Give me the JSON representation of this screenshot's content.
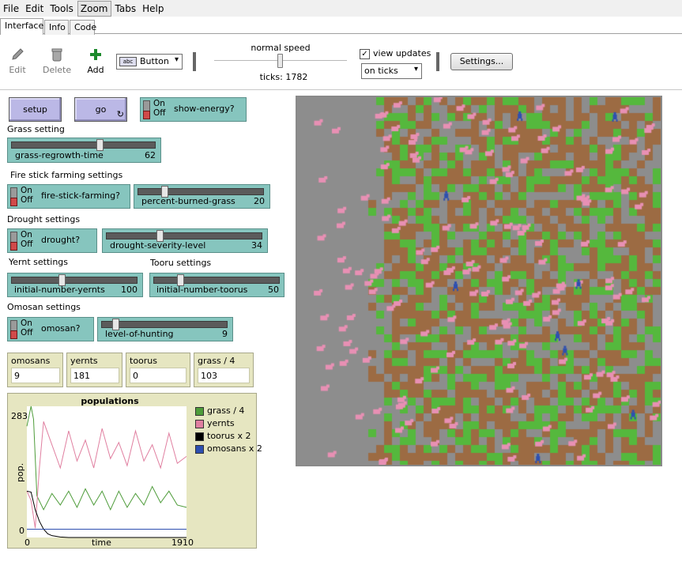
{
  "menubar": {
    "items": [
      "File",
      "Edit",
      "Tools",
      "Zoom",
      "Tabs",
      "Help"
    ]
  },
  "tabs": [
    "Interface",
    "Info",
    "Code"
  ],
  "toolbar": {
    "edit_label": "Edit",
    "delete_label": "Delete",
    "add_label": "Add",
    "widget_type": "Button",
    "speed_label": "normal speed",
    "speed_value": 0.5,
    "ticks_text": "ticks: 1782",
    "view_updates_label": "view updates",
    "view_updates_checked": true,
    "update_mode": "on ticks",
    "settings_label": "Settings..."
  },
  "buttons": {
    "setup": "setup",
    "go": "go"
  },
  "switches": {
    "show_energy": {
      "label": "show-energy?",
      "on": "On",
      "off": "Off",
      "state": "off"
    },
    "fire_stick": {
      "label": "fire-stick-farming?",
      "on": "On",
      "off": "Off",
      "state": "off"
    },
    "drought": {
      "label": "drought?",
      "on": "On",
      "off": "Off",
      "state": "off"
    },
    "omosan": {
      "label": "omosan?",
      "on": "On",
      "off": "Off",
      "state": "off"
    }
  },
  "sections": {
    "grass": "Grass setting",
    "fire": "Fire stick farming settings",
    "drought": "Drought settings",
    "yernt": "Yernt settings",
    "tooru": "Tooru settings",
    "omosan": "Omosan settings"
  },
  "sliders": {
    "grass_regrowth_time": {
      "label": "grass-regrowth-time",
      "value": "62",
      "fraction": 0.62
    },
    "percent_burned_grass": {
      "label": "percent-burned-grass",
      "value": "20",
      "fraction": 0.2
    },
    "drought_severity_level": {
      "label": "drought-severity-level",
      "value": "34",
      "fraction": 0.34
    },
    "initial_number_yernts": {
      "label": "initial-number-yernts",
      "value": "100",
      "fraction": 0.4
    },
    "initial_number_toorus": {
      "label": "initial-number-toorus",
      "value": "50",
      "fraction": 0.2
    },
    "level_of_hunting": {
      "label": "level-of-hunting",
      "value": "9",
      "fraction": 0.09
    }
  },
  "monitors": [
    {
      "label": "omosans",
      "value": "9"
    },
    {
      "label": "yernts",
      "value": "181"
    },
    {
      "label": "toorus",
      "value": "0"
    },
    {
      "label": "grass / 4",
      "value": "103"
    }
  ],
  "plot": {
    "title": "populations",
    "ylabel": "pop.",
    "xlabel": "time",
    "y_max_label": "283",
    "y_min_label": "0",
    "x_min_label": "0",
    "x_max_label": "1910",
    "legend": [
      {
        "name": "grass / 4",
        "color": "#4e9c3a"
      },
      {
        "name": "yernts",
        "color": "#e07fa0"
      },
      {
        "name": "toorus x 2",
        "color": "#000000"
      },
      {
        "name": "omosans x 2",
        "color": "#2d4fb0"
      }
    ]
  },
  "chart_data": {
    "type": "line",
    "title": "populations",
    "xlabel": "time",
    "ylabel": "pop.",
    "xlim": [
      0,
      1910
    ],
    "ylim": [
      0,
      283
    ],
    "series": [
      {
        "name": "grass / 4",
        "color": "#4e9c3a",
        "x": [
          0,
          50,
          80,
          120,
          200,
          300,
          400,
          500,
          600,
          700,
          800,
          900,
          1000,
          1100,
          1200,
          1300,
          1400,
          1500,
          1600,
          1700,
          1800,
          1910
        ],
        "y": [
          240,
          283,
          255,
          90,
          60,
          95,
          70,
          100,
          65,
          105,
          70,
          100,
          60,
          100,
          65,
          95,
          70,
          110,
          75,
          100,
          70,
          65
        ]
      },
      {
        "name": "yernts",
        "color": "#e07fa0",
        "x": [
          0,
          50,
          100,
          150,
          200,
          300,
          400,
          500,
          600,
          700,
          800,
          900,
          1000,
          1100,
          1200,
          1300,
          1400,
          1500,
          1600,
          1700,
          1800,
          1910
        ],
        "y": [
          100,
          80,
          20,
          150,
          250,
          200,
          150,
          230,
          165,
          210,
          150,
          235,
          170,
          205,
          155,
          230,
          165,
          200,
          150,
          225,
          160,
          175
        ]
      },
      {
        "name": "toorus x 2",
        "color": "#000000",
        "x": [
          0,
          50,
          100,
          150,
          200,
          250,
          300,
          400,
          500,
          1910
        ],
        "y": [
          100,
          98,
          60,
          35,
          18,
          8,
          4,
          1,
          0,
          0
        ]
      },
      {
        "name": "omosans x 2",
        "color": "#2d4fb0",
        "x": [
          0,
          1910
        ],
        "y": [
          18,
          18
        ]
      }
    ]
  }
}
